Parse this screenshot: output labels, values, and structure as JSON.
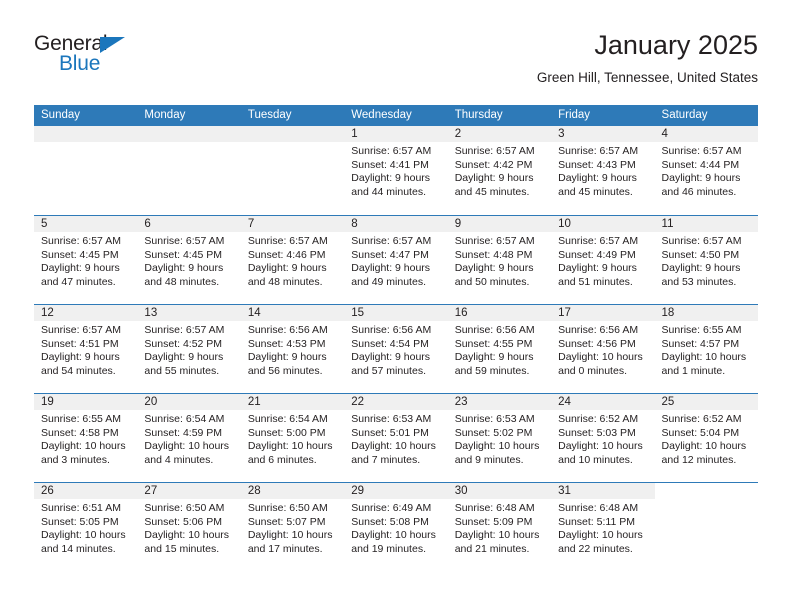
{
  "brand": {
    "name_part1": "General",
    "name_part2": "Blue",
    "accent_color": "#1b76bc"
  },
  "header": {
    "month_title": "January 2025",
    "location": "Green Hill, Tennessee, United States"
  },
  "calendar": {
    "header_color": "#2e7ab8",
    "daynum_strip_color": "#f0f0f0",
    "weekday_labels": [
      "Sunday",
      "Monday",
      "Tuesday",
      "Wednesday",
      "Thursday",
      "Friday",
      "Saturday"
    ],
    "weeks": [
      [
        {
          "day": "",
          "blank": true
        },
        {
          "day": "",
          "blank": true
        },
        {
          "day": "",
          "blank": true
        },
        {
          "day": "1",
          "sunrise": "Sunrise: 6:57 AM",
          "sunset": "Sunset: 4:41 PM",
          "daylight1": "Daylight: 9 hours",
          "daylight2": "and 44 minutes."
        },
        {
          "day": "2",
          "sunrise": "Sunrise: 6:57 AM",
          "sunset": "Sunset: 4:42 PM",
          "daylight1": "Daylight: 9 hours",
          "daylight2": "and 45 minutes."
        },
        {
          "day": "3",
          "sunrise": "Sunrise: 6:57 AM",
          "sunset": "Sunset: 4:43 PM",
          "daylight1": "Daylight: 9 hours",
          "daylight2": "and 45 minutes."
        },
        {
          "day": "4",
          "sunrise": "Sunrise: 6:57 AM",
          "sunset": "Sunset: 4:44 PM",
          "daylight1": "Daylight: 9 hours",
          "daylight2": "and 46 minutes."
        }
      ],
      [
        {
          "day": "5",
          "sunrise": "Sunrise: 6:57 AM",
          "sunset": "Sunset: 4:45 PM",
          "daylight1": "Daylight: 9 hours",
          "daylight2": "and 47 minutes."
        },
        {
          "day": "6",
          "sunrise": "Sunrise: 6:57 AM",
          "sunset": "Sunset: 4:45 PM",
          "daylight1": "Daylight: 9 hours",
          "daylight2": "and 48 minutes."
        },
        {
          "day": "7",
          "sunrise": "Sunrise: 6:57 AM",
          "sunset": "Sunset: 4:46 PM",
          "daylight1": "Daylight: 9 hours",
          "daylight2": "and 48 minutes."
        },
        {
          "day": "8",
          "sunrise": "Sunrise: 6:57 AM",
          "sunset": "Sunset: 4:47 PM",
          "daylight1": "Daylight: 9 hours",
          "daylight2": "and 49 minutes."
        },
        {
          "day": "9",
          "sunrise": "Sunrise: 6:57 AM",
          "sunset": "Sunset: 4:48 PM",
          "daylight1": "Daylight: 9 hours",
          "daylight2": "and 50 minutes."
        },
        {
          "day": "10",
          "sunrise": "Sunrise: 6:57 AM",
          "sunset": "Sunset: 4:49 PM",
          "daylight1": "Daylight: 9 hours",
          "daylight2": "and 51 minutes."
        },
        {
          "day": "11",
          "sunrise": "Sunrise: 6:57 AM",
          "sunset": "Sunset: 4:50 PM",
          "daylight1": "Daylight: 9 hours",
          "daylight2": "and 53 minutes."
        }
      ],
      [
        {
          "day": "12",
          "sunrise": "Sunrise: 6:57 AM",
          "sunset": "Sunset: 4:51 PM",
          "daylight1": "Daylight: 9 hours",
          "daylight2": "and 54 minutes."
        },
        {
          "day": "13",
          "sunrise": "Sunrise: 6:57 AM",
          "sunset": "Sunset: 4:52 PM",
          "daylight1": "Daylight: 9 hours",
          "daylight2": "and 55 minutes."
        },
        {
          "day": "14",
          "sunrise": "Sunrise: 6:56 AM",
          "sunset": "Sunset: 4:53 PM",
          "daylight1": "Daylight: 9 hours",
          "daylight2": "and 56 minutes."
        },
        {
          "day": "15",
          "sunrise": "Sunrise: 6:56 AM",
          "sunset": "Sunset: 4:54 PM",
          "daylight1": "Daylight: 9 hours",
          "daylight2": "and 57 minutes."
        },
        {
          "day": "16",
          "sunrise": "Sunrise: 6:56 AM",
          "sunset": "Sunset: 4:55 PM",
          "daylight1": "Daylight: 9 hours",
          "daylight2": "and 59 minutes."
        },
        {
          "day": "17",
          "sunrise": "Sunrise: 6:56 AM",
          "sunset": "Sunset: 4:56 PM",
          "daylight1": "Daylight: 10 hours",
          "daylight2": "and 0 minutes."
        },
        {
          "day": "18",
          "sunrise": "Sunrise: 6:55 AM",
          "sunset": "Sunset: 4:57 PM",
          "daylight1": "Daylight: 10 hours",
          "daylight2": "and 1 minute."
        }
      ],
      [
        {
          "day": "19",
          "sunrise": "Sunrise: 6:55 AM",
          "sunset": "Sunset: 4:58 PM",
          "daylight1": "Daylight: 10 hours",
          "daylight2": "and 3 minutes."
        },
        {
          "day": "20",
          "sunrise": "Sunrise: 6:54 AM",
          "sunset": "Sunset: 4:59 PM",
          "daylight1": "Daylight: 10 hours",
          "daylight2": "and 4 minutes."
        },
        {
          "day": "21",
          "sunrise": "Sunrise: 6:54 AM",
          "sunset": "Sunset: 5:00 PM",
          "daylight1": "Daylight: 10 hours",
          "daylight2": "and 6 minutes."
        },
        {
          "day": "22",
          "sunrise": "Sunrise: 6:53 AM",
          "sunset": "Sunset: 5:01 PM",
          "daylight1": "Daylight: 10 hours",
          "daylight2": "and 7 minutes."
        },
        {
          "day": "23",
          "sunrise": "Sunrise: 6:53 AM",
          "sunset": "Sunset: 5:02 PM",
          "daylight1": "Daylight: 10 hours",
          "daylight2": "and 9 minutes."
        },
        {
          "day": "24",
          "sunrise": "Sunrise: 6:52 AM",
          "sunset": "Sunset: 5:03 PM",
          "daylight1": "Daylight: 10 hours",
          "daylight2": "and 10 minutes."
        },
        {
          "day": "25",
          "sunrise": "Sunrise: 6:52 AM",
          "sunset": "Sunset: 5:04 PM",
          "daylight1": "Daylight: 10 hours",
          "daylight2": "and 12 minutes."
        }
      ],
      [
        {
          "day": "26",
          "sunrise": "Sunrise: 6:51 AM",
          "sunset": "Sunset: 5:05 PM",
          "daylight1": "Daylight: 10 hours",
          "daylight2": "and 14 minutes."
        },
        {
          "day": "27",
          "sunrise": "Sunrise: 6:50 AM",
          "sunset": "Sunset: 5:06 PM",
          "daylight1": "Daylight: 10 hours",
          "daylight2": "and 15 minutes."
        },
        {
          "day": "28",
          "sunrise": "Sunrise: 6:50 AM",
          "sunset": "Sunset: 5:07 PM",
          "daylight1": "Daylight: 10 hours",
          "daylight2": "and 17 minutes."
        },
        {
          "day": "29",
          "sunrise": "Sunrise: 6:49 AM",
          "sunset": "Sunset: 5:08 PM",
          "daylight1": "Daylight: 10 hours",
          "daylight2": "and 19 minutes."
        },
        {
          "day": "30",
          "sunrise": "Sunrise: 6:48 AM",
          "sunset": "Sunset: 5:09 PM",
          "daylight1": "Daylight: 10 hours",
          "daylight2": "and 21 minutes."
        },
        {
          "day": "31",
          "sunrise": "Sunrise: 6:48 AM",
          "sunset": "Sunset: 5:11 PM",
          "daylight1": "Daylight: 10 hours",
          "daylight2": "and 22 minutes."
        },
        {
          "day": "",
          "trailing": true
        }
      ]
    ]
  }
}
